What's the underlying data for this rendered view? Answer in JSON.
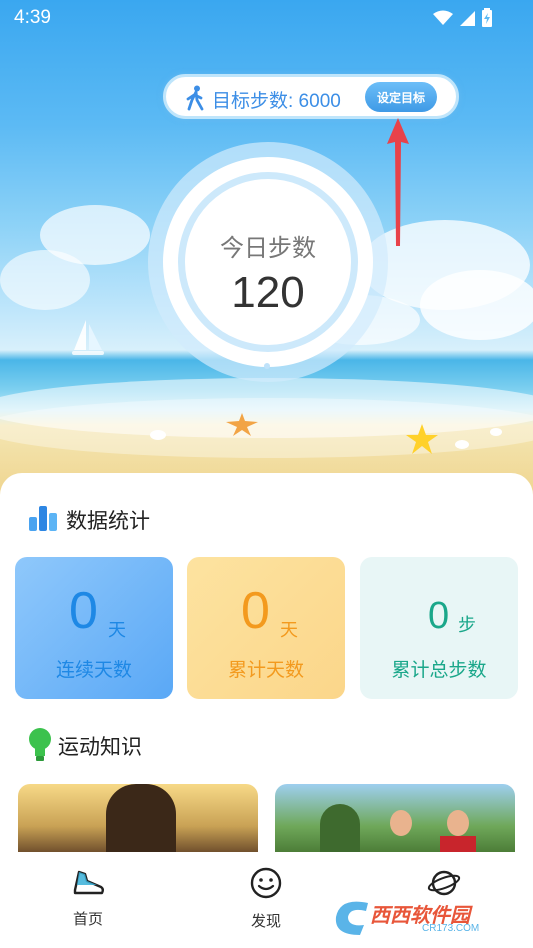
{
  "status_bar": {
    "time": "4:39"
  },
  "goal": {
    "label": "目标步数: 6000",
    "button_label": "设定目标"
  },
  "today": {
    "label": "今日步数",
    "value": "120"
  },
  "stats_section": {
    "title": "数据统计"
  },
  "stats": [
    {
      "value": "0",
      "unit": "天",
      "label": "连续天数",
      "color": "#1e88e5"
    },
    {
      "value": "0",
      "unit": "天",
      "label": "累计天数",
      "color": "#f39a1e"
    },
    {
      "value": "0",
      "unit": "步",
      "label": "累计总步数",
      "color": "#1aa78a"
    }
  ],
  "knowledge_section": {
    "title": "运动知识"
  },
  "nav": [
    {
      "label": "首页",
      "icon": "shoe-icon"
    },
    {
      "label": "发现",
      "icon": "smile-icon"
    },
    {
      "label": "",
      "icon": "planet-icon"
    }
  ],
  "watermark": {
    "text": "西西软件园",
    "subtext": "CR173.COM"
  },
  "colors": {
    "accent": "#3c8ee6",
    "goal_arrow": "#e8424a"
  }
}
